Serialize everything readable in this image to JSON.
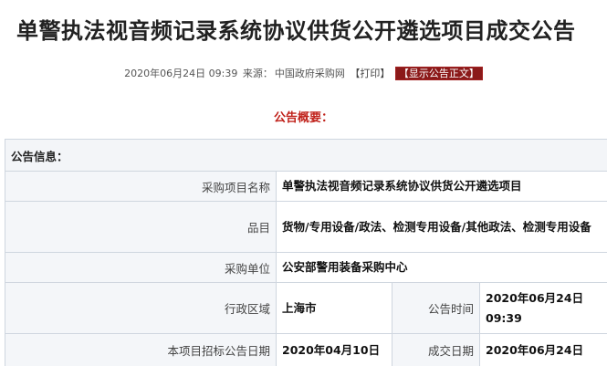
{
  "title": "单警执法视音频记录系统协议供货公开遴选项目成交公告",
  "meta": {
    "date": "2020年06月24日 09:39",
    "source_label": "来源：",
    "source": "中国政府采购网",
    "print": "【打印】",
    "show_full": "【显示公告正文】"
  },
  "summary_heading": "公告概要：",
  "info": {
    "section_title": "公告信息：",
    "rows": {
      "project_name": {
        "label": "采购项目名称",
        "value": "单警执法视音频记录系统协议供货公开遴选项目"
      },
      "category": {
        "label": "品目",
        "value": "货物/专用设备/政法、检测专用设备/其他政法、检测专用设备"
      },
      "purchaser": {
        "label": "采购单位",
        "value": "公安部警用装备采购中心"
      },
      "region": {
        "label": "行政区域",
        "value": "上海市"
      },
      "announce_time": {
        "label": "公告时间",
        "value": "2020年06月24日 09:39"
      },
      "tender_date": {
        "label": "本项目招标公告日期",
        "value": "2020年04月10日"
      },
      "deal_date": {
        "label": "成交日期",
        "value": "2020年06月24日"
      }
    }
  }
}
